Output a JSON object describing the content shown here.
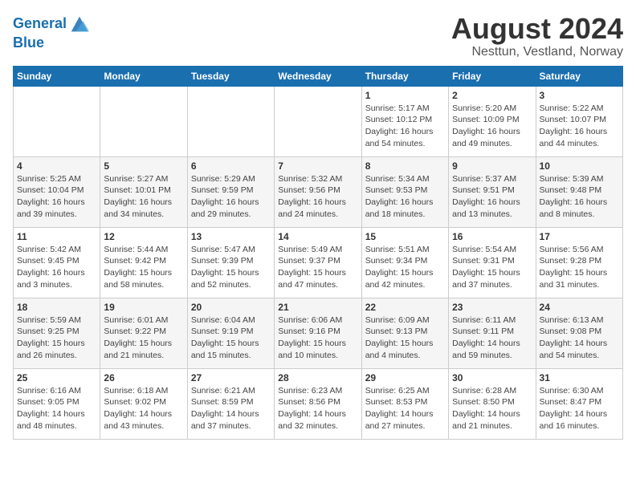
{
  "header": {
    "logo_line1": "General",
    "logo_line2": "Blue",
    "main_title": "August 2024",
    "subtitle": "Nesttun, Vestland, Norway"
  },
  "days_of_week": [
    "Sunday",
    "Monday",
    "Tuesday",
    "Wednesday",
    "Thursday",
    "Friday",
    "Saturday"
  ],
  "weeks": [
    [
      {
        "day": "",
        "info": ""
      },
      {
        "day": "",
        "info": ""
      },
      {
        "day": "",
        "info": ""
      },
      {
        "day": "",
        "info": ""
      },
      {
        "day": "1",
        "info": "Sunrise: 5:17 AM\nSunset: 10:12 PM\nDaylight: 16 hours\nand 54 minutes."
      },
      {
        "day": "2",
        "info": "Sunrise: 5:20 AM\nSunset: 10:09 PM\nDaylight: 16 hours\nand 49 minutes."
      },
      {
        "day": "3",
        "info": "Sunrise: 5:22 AM\nSunset: 10:07 PM\nDaylight: 16 hours\nand 44 minutes."
      }
    ],
    [
      {
        "day": "4",
        "info": "Sunrise: 5:25 AM\nSunset: 10:04 PM\nDaylight: 16 hours\nand 39 minutes."
      },
      {
        "day": "5",
        "info": "Sunrise: 5:27 AM\nSunset: 10:01 PM\nDaylight: 16 hours\nand 34 minutes."
      },
      {
        "day": "6",
        "info": "Sunrise: 5:29 AM\nSunset: 9:59 PM\nDaylight: 16 hours\nand 29 minutes."
      },
      {
        "day": "7",
        "info": "Sunrise: 5:32 AM\nSunset: 9:56 PM\nDaylight: 16 hours\nand 24 minutes."
      },
      {
        "day": "8",
        "info": "Sunrise: 5:34 AM\nSunset: 9:53 PM\nDaylight: 16 hours\nand 18 minutes."
      },
      {
        "day": "9",
        "info": "Sunrise: 5:37 AM\nSunset: 9:51 PM\nDaylight: 16 hours\nand 13 minutes."
      },
      {
        "day": "10",
        "info": "Sunrise: 5:39 AM\nSunset: 9:48 PM\nDaylight: 16 hours\nand 8 minutes."
      }
    ],
    [
      {
        "day": "11",
        "info": "Sunrise: 5:42 AM\nSunset: 9:45 PM\nDaylight: 16 hours\nand 3 minutes."
      },
      {
        "day": "12",
        "info": "Sunrise: 5:44 AM\nSunset: 9:42 PM\nDaylight: 15 hours\nand 58 minutes."
      },
      {
        "day": "13",
        "info": "Sunrise: 5:47 AM\nSunset: 9:39 PM\nDaylight: 15 hours\nand 52 minutes."
      },
      {
        "day": "14",
        "info": "Sunrise: 5:49 AM\nSunset: 9:37 PM\nDaylight: 15 hours\nand 47 minutes."
      },
      {
        "day": "15",
        "info": "Sunrise: 5:51 AM\nSunset: 9:34 PM\nDaylight: 15 hours\nand 42 minutes."
      },
      {
        "day": "16",
        "info": "Sunrise: 5:54 AM\nSunset: 9:31 PM\nDaylight: 15 hours\nand 37 minutes."
      },
      {
        "day": "17",
        "info": "Sunrise: 5:56 AM\nSunset: 9:28 PM\nDaylight: 15 hours\nand 31 minutes."
      }
    ],
    [
      {
        "day": "18",
        "info": "Sunrise: 5:59 AM\nSunset: 9:25 PM\nDaylight: 15 hours\nand 26 minutes."
      },
      {
        "day": "19",
        "info": "Sunrise: 6:01 AM\nSunset: 9:22 PM\nDaylight: 15 hours\nand 21 minutes."
      },
      {
        "day": "20",
        "info": "Sunrise: 6:04 AM\nSunset: 9:19 PM\nDaylight: 15 hours\nand 15 minutes."
      },
      {
        "day": "21",
        "info": "Sunrise: 6:06 AM\nSunset: 9:16 PM\nDaylight: 15 hours\nand 10 minutes."
      },
      {
        "day": "22",
        "info": "Sunrise: 6:09 AM\nSunset: 9:13 PM\nDaylight: 15 hours\nand 4 minutes."
      },
      {
        "day": "23",
        "info": "Sunrise: 6:11 AM\nSunset: 9:11 PM\nDaylight: 14 hours\nand 59 minutes."
      },
      {
        "day": "24",
        "info": "Sunrise: 6:13 AM\nSunset: 9:08 PM\nDaylight: 14 hours\nand 54 minutes."
      }
    ],
    [
      {
        "day": "25",
        "info": "Sunrise: 6:16 AM\nSunset: 9:05 PM\nDaylight: 14 hours\nand 48 minutes."
      },
      {
        "day": "26",
        "info": "Sunrise: 6:18 AM\nSunset: 9:02 PM\nDaylight: 14 hours\nand 43 minutes."
      },
      {
        "day": "27",
        "info": "Sunrise: 6:21 AM\nSunset: 8:59 PM\nDaylight: 14 hours\nand 37 minutes."
      },
      {
        "day": "28",
        "info": "Sunrise: 6:23 AM\nSunset: 8:56 PM\nDaylight: 14 hours\nand 32 minutes."
      },
      {
        "day": "29",
        "info": "Sunrise: 6:25 AM\nSunset: 8:53 PM\nDaylight: 14 hours\nand 27 minutes."
      },
      {
        "day": "30",
        "info": "Sunrise: 6:28 AM\nSunset: 8:50 PM\nDaylight: 14 hours\nand 21 minutes."
      },
      {
        "day": "31",
        "info": "Sunrise: 6:30 AM\nSunset: 8:47 PM\nDaylight: 14 hours\nand 16 minutes."
      }
    ]
  ]
}
